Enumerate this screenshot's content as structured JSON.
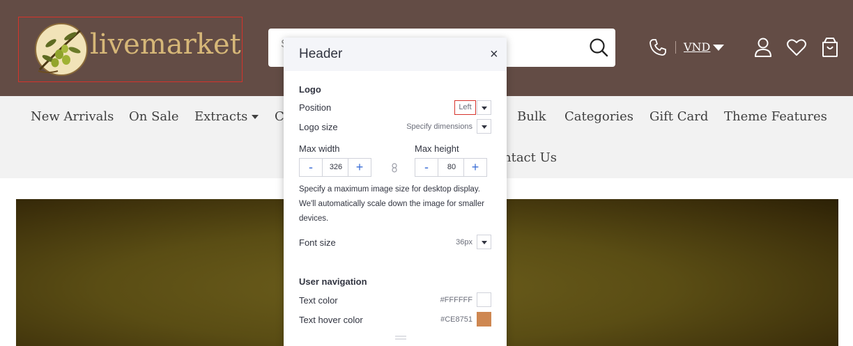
{
  "header": {
    "logo_text": "livemarket",
    "search_placeholder": "S",
    "currency": "VND"
  },
  "nav": {
    "items": [
      "New Arrivals",
      "On Sale",
      "Extracts",
      "C",
      "Bulk",
      "Categories",
      "Gift Card",
      "Theme Features",
      "ntact Us"
    ]
  },
  "panel": {
    "title": "Header",
    "close": "×",
    "logo_section": "Logo",
    "position_label": "Position",
    "position_value": "Left",
    "logo_size_label": "Logo size",
    "logo_size_value": "Specify dimensions",
    "max_width_label": "Max width",
    "max_width_value": "326",
    "max_height_label": "Max height",
    "max_height_value": "80",
    "minus": "-",
    "plus": "+",
    "help_text": "Specify a maximum image size for desktop display. We'll automatically scale down the image for smaller devices.",
    "font_size_label": "Font size",
    "font_size_value": "36px",
    "user_nav_section": "User navigation",
    "text_color_label": "Text color",
    "text_color_value": "#FFFFFF",
    "text_hover_label": "Text hover color",
    "text_hover_value": "#CE8751"
  },
  "colors": {
    "header_bg": "#634c45",
    "nav_bg": "#f2f2f2",
    "logo_text": "#d6b778",
    "text_color_swatch": "#FFFFFF",
    "text_hover_swatch": "#CE8751",
    "accent_blue": "#3b6ed6"
  }
}
